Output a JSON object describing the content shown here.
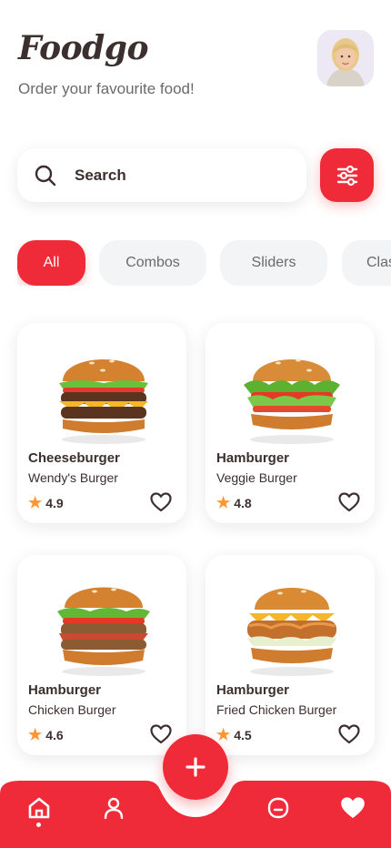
{
  "header": {
    "app_name": "Foodgo",
    "tagline": "Order your favourite food!"
  },
  "profile": {
    "avatar_icon": "user-avatar"
  },
  "search": {
    "label": "Search"
  },
  "filter_button": {
    "icon": "sliders-icon"
  },
  "categories": [
    {
      "label": "All",
      "active": true
    },
    {
      "label": "Combos",
      "active": false
    },
    {
      "label": "Sliders",
      "active": false
    },
    {
      "label": "Classic",
      "active": false
    }
  ],
  "products": [
    {
      "name": "Cheeseburger",
      "description": "Wendy's Burger",
      "rating": "4.9"
    },
    {
      "name": "Hamburger",
      "description": "Veggie Burger",
      "rating": "4.8"
    },
    {
      "name": "Hamburger",
      "description": "Chicken Burger",
      "rating": "4.6"
    },
    {
      "name": "Hamburger",
      "description": "Fried Chicken Burger",
      "rating": "4.5"
    }
  ],
  "nav": {
    "items": [
      "home-icon",
      "profile-icon",
      "chat-icon",
      "favorites-icon"
    ],
    "fab_icon": "plus-icon"
  },
  "colors": {
    "accent": "#ef2a39",
    "text_dark": "#3c2f2f",
    "text_muted": "#6a6a6a",
    "chip_bg": "#f3f4f6",
    "star": "#ff9633"
  }
}
